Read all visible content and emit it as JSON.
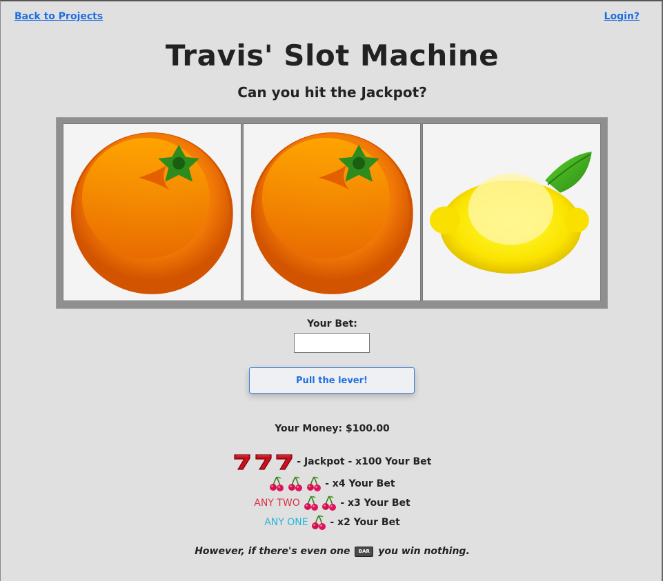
{
  "nav": {
    "back_label": "Back to Projects",
    "login_label": "Login?"
  },
  "header": {
    "title": "Travis' Slot Machine",
    "subtitle": "Can you hit the Jackpot?"
  },
  "reels": [
    {
      "symbol": "orange-icon"
    },
    {
      "symbol": "orange-icon"
    },
    {
      "symbol": "lemon-icon"
    }
  ],
  "bet": {
    "label": "Your Bet:",
    "value": "",
    "placeholder": ""
  },
  "lever": {
    "label": "Pull the lever!"
  },
  "money": {
    "text": "Your Money: $100.00"
  },
  "payouts": {
    "jackpot": "- Jackpot - x100 Your Bet",
    "three_cherries": "- x4 Your Bet",
    "any_two_prefix": "ANY TWO",
    "any_two": "- x3 Your Bet",
    "any_one_prefix": "ANY ONE",
    "any_one": "- x2 Your Bet"
  },
  "disclaimer": {
    "before": "However, if there's even one",
    "bar_label": "BAR",
    "after": "you win nothing."
  },
  "colors": {
    "link": "#1f6fe0",
    "any_two": "#d9334a",
    "any_one": "#27b6d8",
    "frame": "#8f8f8f",
    "background": "#e0e0e0"
  }
}
